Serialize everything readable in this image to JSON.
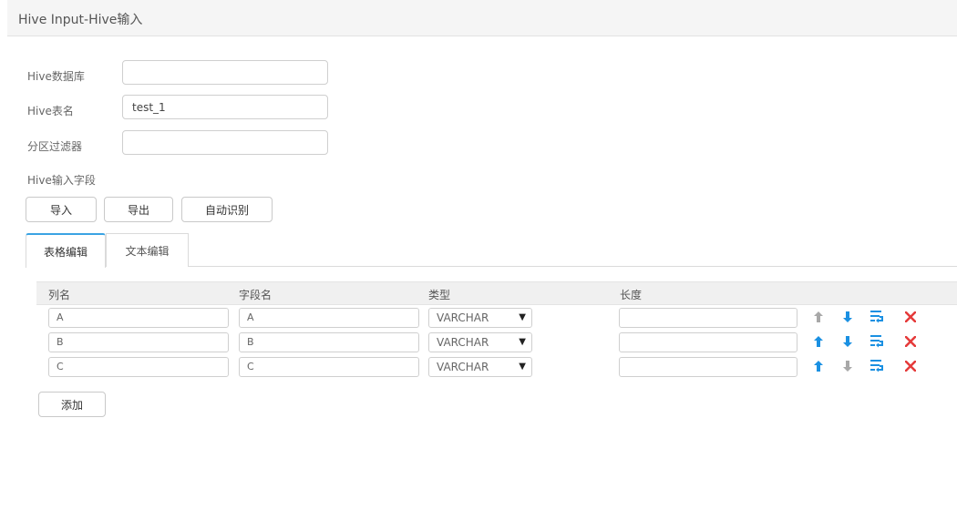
{
  "window": {
    "title": "Hive Input-Hive输入"
  },
  "form": {
    "database": {
      "label": "Hive数据库",
      "value": ""
    },
    "table": {
      "label": "Hive表名",
      "value": "test_1"
    },
    "partition_filter": {
      "label": "分区过滤器",
      "value": ""
    },
    "fields_section_label": "Hive输入字段"
  },
  "toolbar": {
    "import_label": "导入",
    "export_label": "导出",
    "auto_detect_label": "自动识别"
  },
  "tabs": [
    {
      "label": "表格编辑",
      "active": true
    },
    {
      "label": "文本编辑",
      "active": false
    }
  ],
  "table": {
    "columns": [
      "列名",
      "字段名",
      "类型",
      "长度"
    ],
    "rows": [
      {
        "column": "A",
        "field": "A",
        "type": "VARCHAR",
        "length": "",
        "up_enabled": false,
        "down_enabled": true
      },
      {
        "column": "B",
        "field": "B",
        "type": "VARCHAR",
        "length": "",
        "up_enabled": true,
        "down_enabled": true
      },
      {
        "column": "C",
        "field": "C",
        "type": "VARCHAR",
        "length": "",
        "up_enabled": true,
        "down_enabled": false
      }
    ]
  },
  "add_button_label": "添加",
  "colors": {
    "accent": "#1a90e2",
    "delete": "#e53b3b",
    "disabled": "#a8a8a8",
    "tab_active_border": "#3aa3e3"
  }
}
